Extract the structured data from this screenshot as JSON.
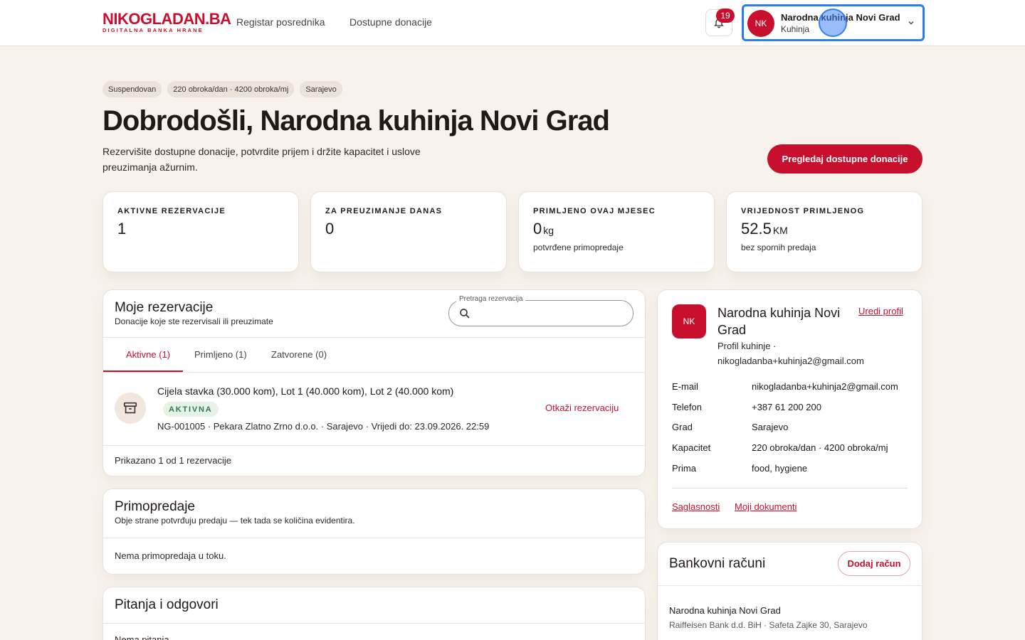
{
  "brand": {
    "logo_main": "NIKOGLADAN.BA",
    "logo_sub": "DIGITALNA BANKA HRANE",
    "accent": "#c8102e"
  },
  "nav": {
    "link1": "Registar posrednika",
    "link2": "Dostupne donacije"
  },
  "notifications": {
    "count": "19",
    "icon": "bell-icon"
  },
  "account": {
    "initials": "NK",
    "name": "Narodna kuhinja Novi Grad",
    "role": "Kuhinja",
    "icon": "chevron-down-icon",
    "focus_color": "#2b7de9"
  },
  "hero": {
    "pills": [
      "Suspendovan",
      "220 obroka/dan · 4200 obroka/mj",
      "Sarajevo"
    ],
    "title": "Dobrodošli, Narodna kuhinja Novi Grad",
    "subtitle": "Rezervišite dostupne donacije, potvrdite prijem i držite kapacitet i uslove preuzimanja ažurnim.",
    "cta": "Pregledaj dostupne donacije"
  },
  "stats": [
    {
      "label": "AKTIVNE REZERVACIJE",
      "value": "1",
      "unit": "",
      "note": ""
    },
    {
      "label": "ZA PREUZIMANJE DANAS",
      "value": "0",
      "unit": "",
      "note": ""
    },
    {
      "label": "PRIMLJENO OVAJ MJESEC",
      "value": "0",
      "unit": "kg",
      "note": "potvrđene primopredaje"
    },
    {
      "label": "VRIJEDNOST PRIMLJENOG",
      "value": "52.5",
      "unit": "KM",
      "note": "bez spornih predaja"
    }
  ],
  "reservations": {
    "title": "Moje rezervacije",
    "subtitle": "Donacije koje ste rezervisali ili preuzimate",
    "search_legend": "Pretraga rezervacija",
    "search_value": "",
    "search_placeholder": "",
    "tabs": [
      "Aktivne (1)",
      "Primljeno (1)",
      "Zatvorene (0)"
    ],
    "items": [
      {
        "title": "Cijela stavka (30.000 kom), Lot 1 (40.000 kom), Lot 2 (40.000 kom)",
        "status": "AKTIVNA",
        "meta": "NG-001005 · Pekara Zlatno Zrno d.o.o. · Sarajevo · Vrijedi do: 23.09.2026. 22:59",
        "action": "Otkaži rezervaciju",
        "icon": "archive-box-icon"
      }
    ],
    "footer": "Prikazano 1 od 1 rezervacije"
  },
  "handovers": {
    "title": "Primopredaje",
    "subtitle": "Obje strane potvrđuju predaju — tek tada se količina evidentira.",
    "empty": "Nema primopredaja u toku."
  },
  "qa": {
    "title": "Pitanja i odgovori",
    "empty": "Nema pitanja"
  },
  "profile": {
    "initials": "NK",
    "name": "Narodna kuhinja Novi Grad",
    "desc": "Profil kuhinje · nikogladanba+kuhinja2@gmail.com",
    "edit": "Uredi profil",
    "fields": [
      {
        "k": "E-mail",
        "v": "nikogladanba+kuhinja2@gmail.com"
      },
      {
        "k": "Telefon",
        "v": "+387 61 200 200"
      },
      {
        "k": "Grad",
        "v": "Sarajevo"
      },
      {
        "k": "Kapacitet",
        "v": "220 obroka/dan · 4200 obroka/mj"
      },
      {
        "k": "Prima",
        "v": "food, hygiene"
      }
    ],
    "link1": "Saglasnosti",
    "link2": "Moji dokumenti"
  },
  "bank": {
    "title": "Bankovni računi",
    "add": "Dodaj račun",
    "account_name": "Narodna kuhinja Novi Grad",
    "account_meta": "Raiffeisen Bank d.d. BiH · Safeta Zajke 30, Sarajevo"
  }
}
